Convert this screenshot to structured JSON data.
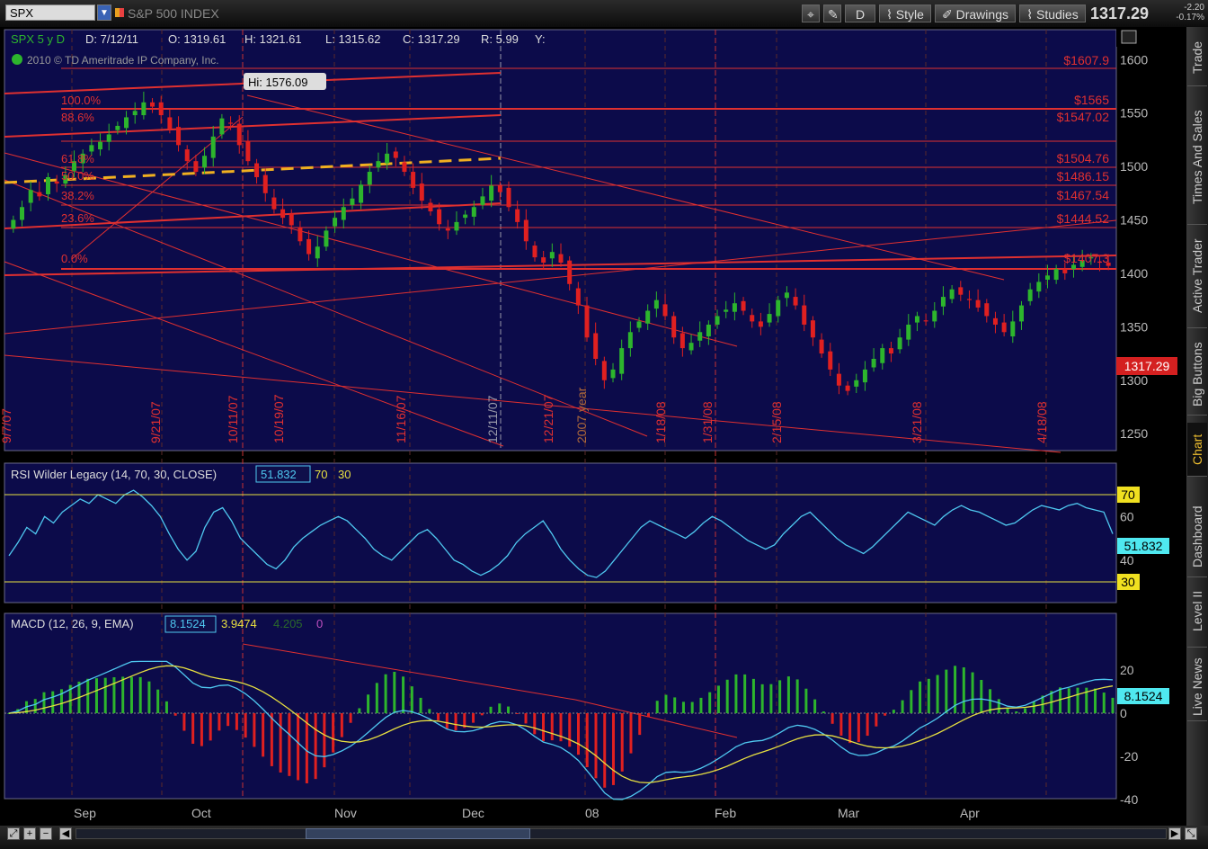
{
  "toolbar": {
    "symbol": "SPX",
    "index_name": "S&P 500 INDEX",
    "d_label": "D",
    "style_label": "Style",
    "drawings_label": "Drawings",
    "studies_label": "Studies",
    "last_price": "1317.29",
    "change": "-2.20",
    "change_pct": "-0.17%"
  },
  "side_tabs": [
    "Trade",
    "Times And Sales",
    "Active Trader",
    "Big Buttons",
    "Chart",
    "Dashboard",
    "Level II",
    "Live News"
  ],
  "price_panel": {
    "header": "SPX 5 y D",
    "fields": [
      "D: 7/12/11",
      "O: 1319.61",
      "H: 1321.61",
      "L: 1315.62",
      "C: 1317.29",
      "R: 5.99",
      "Y:"
    ],
    "copyright": "2010 © TD Ameritrade IP Company, Inc.",
    "hi_label": "Hi: 1576.09",
    "price_tag": "1317.29",
    "fib_labels": [
      "100.0%",
      "88.6%",
      "61.8%",
      "50.0%",
      "38.2%",
      "23.6%",
      "0.0%"
    ],
    "level_labels": [
      "$1607.9",
      "$1565",
      "$1547.02",
      "$1504.76",
      "$1486.15",
      "$1467.54",
      "$1444.52",
      "$1407.3"
    ],
    "date_labels": [
      "9/7/07",
      "9/21/07",
      "10/11/07",
      "10/19/07",
      "11/16/07",
      "12/11/07",
      "12/21/07",
      "2007 year",
      "1/18/08",
      "1/31/08",
      "2/15/08",
      "3/21/08",
      "4/18/08"
    ]
  },
  "rsi_panel": {
    "label": "RSI Wilder Legacy (14, 70, 30, CLOSE)",
    "value": "51.832",
    "ob": "70",
    "os": "30",
    "tag_value": "51.832"
  },
  "macd_panel": {
    "label": "MACD (12, 26, 9, EMA)",
    "macd": "8.1524",
    "signal": "3.9474",
    "hist": "4.205",
    "zero": "0",
    "tag_value": "8.1524"
  },
  "chart_data": {
    "type": "candlestick",
    "price_axis": {
      "ticks": [
        "1600",
        "1550",
        "1500",
        "1450",
        "1400",
        "1350",
        "1300",
        "1250"
      ],
      "range": [
        1235,
        1628
      ]
    },
    "rsi_axis": {
      "ticks": [
        "60",
        "40"
      ],
      "range": [
        0,
        100
      ]
    },
    "macd_axis": {
      "ticks": [
        "20",
        "0",
        "-20",
        "-40"
      ],
      "range": [
        -44,
        24
      ]
    },
    "time_axis": [
      "Sep",
      "Oct",
      "Nov",
      "Dec",
      "08",
      "Feb",
      "Mar",
      "Apr"
    ],
    "close_series": [
      1450,
      1462,
      1478,
      1472,
      1490,
      1484,
      1492,
      1505,
      1512,
      1520,
      1523,
      1530,
      1538,
      1546,
      1552,
      1560,
      1556,
      1548,
      1535,
      1520,
      1505,
      1495,
      1510,
      1528,
      1545,
      1540,
      1520,
      1505,
      1490,
      1475,
      1460,
      1452,
      1445,
      1430,
      1418,
      1425,
      1440,
      1452,
      1462,
      1470,
      1483,
      1495,
      1505,
      1512,
      1508,
      1495,
      1480,
      1468,
      1458,
      1446,
      1440,
      1448,
      1455,
      1462,
      1472,
      1482,
      1476,
      1462,
      1448,
      1430,
      1415,
      1410,
      1420,
      1410,
      1390,
      1370,
      1340,
      1320,
      1300,
      1310,
      1330,
      1345,
      1355,
      1365,
      1375,
      1360,
      1340,
      1330,
      1335,
      1345,
      1352,
      1360,
      1366,
      1372,
      1365,
      1355,
      1350,
      1362,
      1375,
      1382,
      1370,
      1352,
      1340,
      1325,
      1310,
      1295,
      1290,
      1300,
      1310,
      1320,
      1330,
      1325,
      1340,
      1352,
      1360,
      1355,
      1365,
      1378,
      1385,
      1380,
      1375,
      1368,
      1360,
      1352,
      1345,
      1355,
      1370,
      1385,
      1392,
      1398,
      1404,
      1400,
      1408,
      1412,
      1415,
      1410,
      1407
    ],
    "rsi_series": [
      42,
      48,
      55,
      52,
      60,
      57,
      62,
      65,
      68,
      66,
      70,
      68,
      66,
      70,
      72,
      69,
      65,
      60,
      52,
      45,
      40,
      44,
      55,
      62,
      64,
      58,
      50,
      46,
      42,
      38,
      36,
      40,
      46,
      50,
      53,
      56,
      58,
      60,
      58,
      54,
      50,
      45,
      42,
      40,
      44,
      48,
      52,
      54,
      50,
      45,
      40,
      38,
      35,
      33,
      35,
      38,
      42,
      48,
      52,
      55,
      58,
      52,
      45,
      40,
      36,
      33,
      32,
      35,
      40,
      45,
      50,
      55,
      58,
      56,
      54,
      52,
      50,
      53,
      57,
      60,
      58,
      55,
      52,
      49,
      47,
      45,
      47,
      52,
      56,
      60,
      62,
      58,
      54,
      50,
      47,
      45,
      43,
      46,
      50,
      54,
      58,
      62,
      60,
      58,
      56,
      60,
      63,
      65,
      63,
      62,
      60,
      58,
      56,
      57,
      60,
      63,
      65,
      64,
      63,
      65,
      66,
      64,
      63,
      62,
      52
    ]
  },
  "colors": {
    "panel_bg": "#0c0b4a",
    "panel_border": "#6a6a8a",
    "grid": "#5a2a2a",
    "up_candle": "#2db52d",
    "down_candle": "#e02020",
    "trendline": "#e03030",
    "dashed_line": "#f0b020",
    "rsi_line": "#4fc8f0",
    "macd_line": "#4fc8f0",
    "signal_line": "#e8e040",
    "price_tag_bg": "#d42020"
  }
}
